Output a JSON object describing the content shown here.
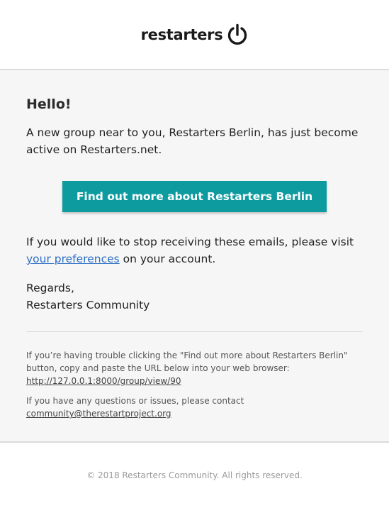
{
  "header": {
    "logo_text": "restarters",
    "logo_icon": "power-icon"
  },
  "email": {
    "greeting": "Hello!",
    "intro": "A new group near to you, Restarters Berlin, has just become active on Restarters.net.",
    "button_label": "Find out more about Restarters Berlin",
    "pref_before": "If you would like to stop receiving these emails, please visit ",
    "pref_link": "your preferences",
    "pref_after": " on your account.",
    "regards": "Regards,",
    "signature": "Restarters Community",
    "trouble_text": "If you’re having trouble clicking the \"Find out more about Restarters Berlin\" button, copy and paste the URL below into your web browser:",
    "trouble_url": "http://127.0.0.1:8000/group/view/90",
    "contact_text": "If you have any questions or issues, please contact",
    "contact_email": "community@therestartproject.org"
  },
  "footer": {
    "copyright": "© 2018 Restarters Community. All rights reserved."
  },
  "colors": {
    "button_bg": "#0d9ba0",
    "link": "#2c6fc5",
    "panel_bg": "#f6f6f6"
  }
}
